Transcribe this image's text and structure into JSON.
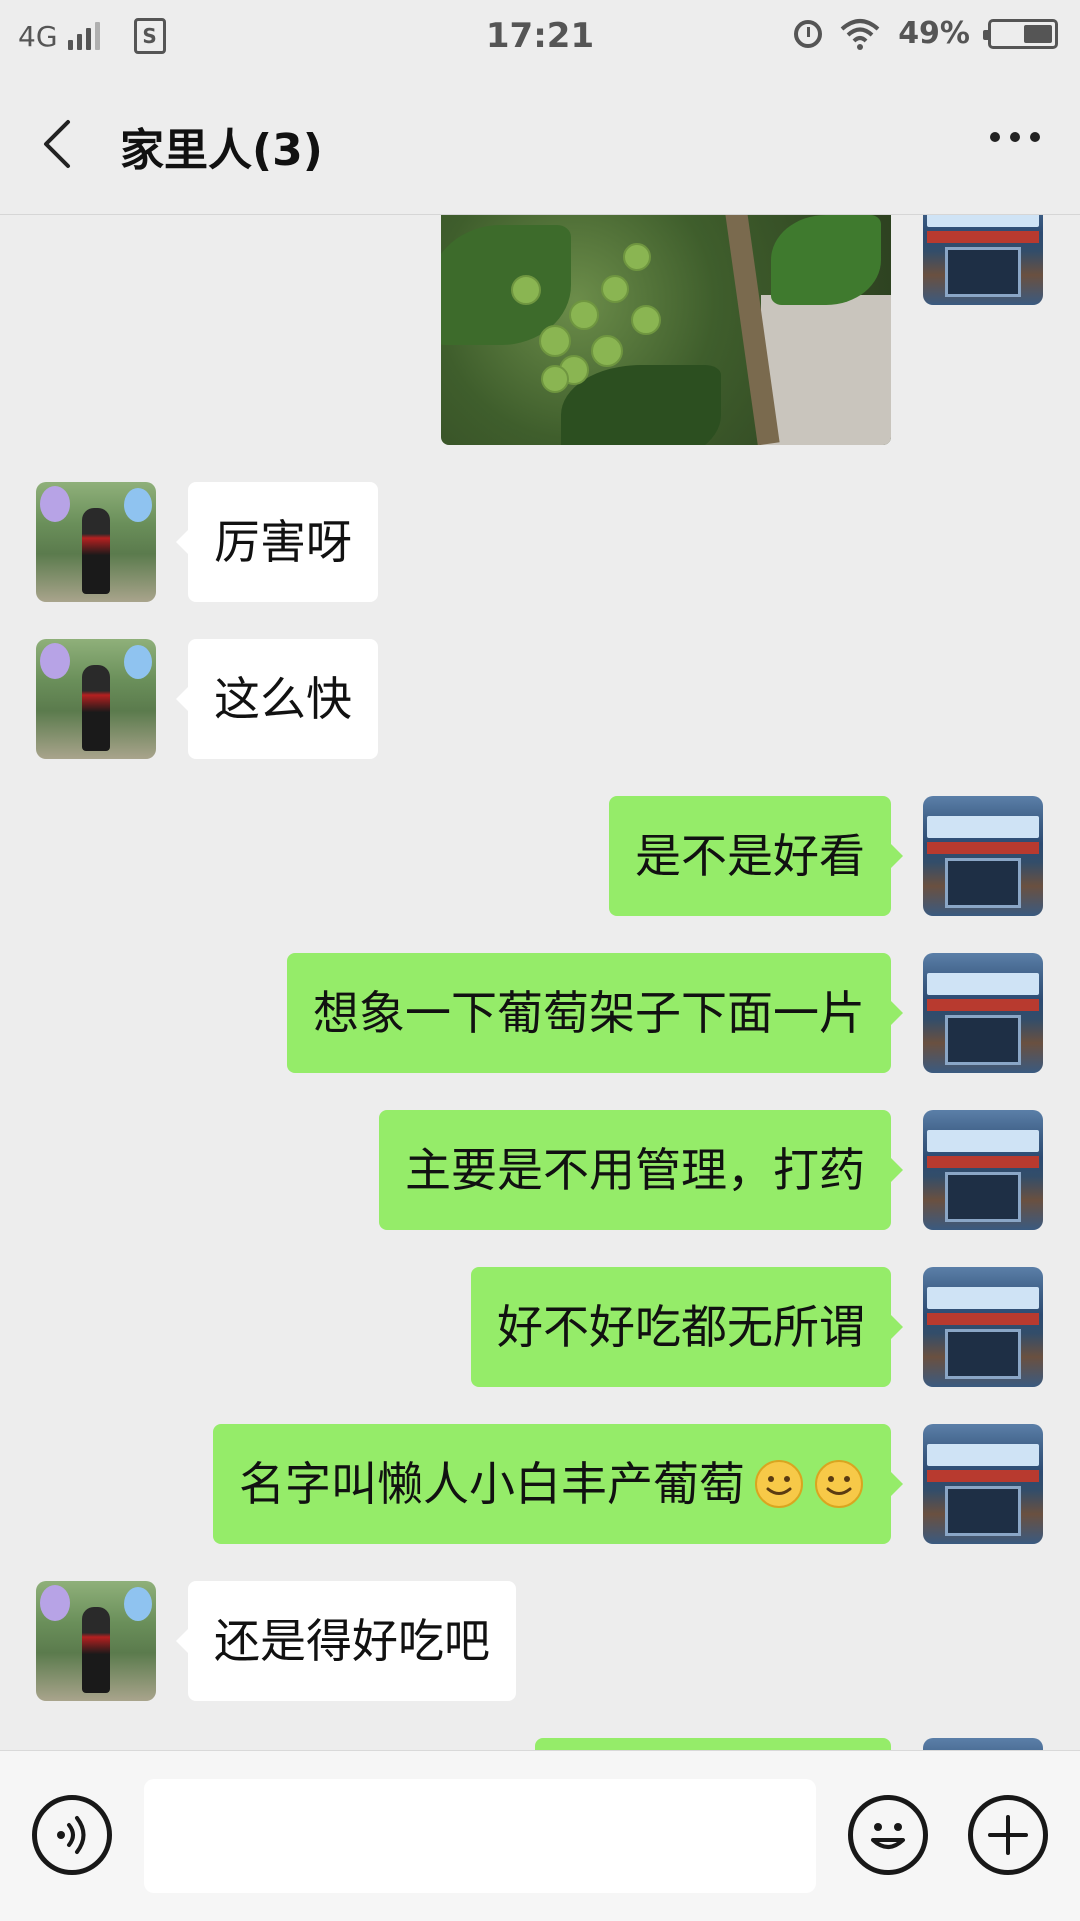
{
  "status_bar": {
    "network": "4G",
    "sim_label": "S",
    "time": "17:21",
    "battery_text": "49%",
    "battery_level": 0.49
  },
  "header": {
    "title": "家里人(3)"
  },
  "messages": [
    {
      "side": "other",
      "type": "text",
      "text": "厉害呀"
    },
    {
      "side": "other",
      "type": "text",
      "text": "这么快"
    },
    {
      "side": "self",
      "type": "text",
      "text": "是不是好看"
    },
    {
      "side": "self",
      "type": "text",
      "text": "想象一下葡萄架子下面一片"
    },
    {
      "side": "self",
      "type": "text",
      "text": "主要是不用管理，打药"
    },
    {
      "side": "self",
      "type": "text",
      "text": "好不好吃都无所谓"
    },
    {
      "side": "self",
      "type": "text",
      "text": "名字叫懒人小白丰产葡萄",
      "emojis": 2
    },
    {
      "side": "other",
      "type": "text",
      "text": "还是得好吃吧"
    }
  ],
  "self_avatar": {
    "banner_small": "中国移动",
    "banner_text": "金海营业厅"
  },
  "input_bar": {
    "placeholder": ""
  },
  "colors": {
    "background": "#ededed",
    "bubble_in": "#ffffff",
    "bubble_out": "#95ec69"
  }
}
